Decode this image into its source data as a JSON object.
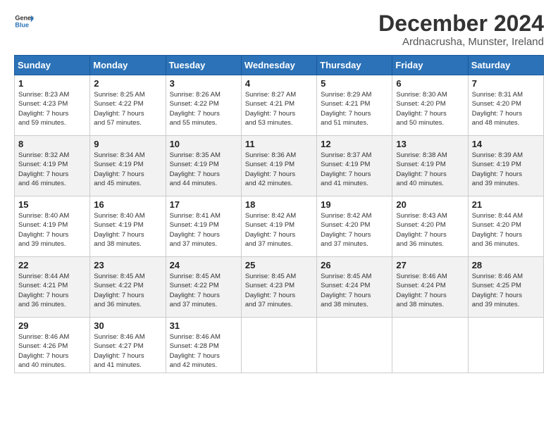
{
  "header": {
    "logo_line1": "General",
    "logo_line2": "Blue",
    "month_title": "December 2024",
    "location": "Ardnacrusha, Munster, Ireland"
  },
  "days_of_week": [
    "Sunday",
    "Monday",
    "Tuesday",
    "Wednesday",
    "Thursday",
    "Friday",
    "Saturday"
  ],
  "weeks": [
    [
      {
        "day": "1",
        "info": "Sunrise: 8:23 AM\nSunset: 4:23 PM\nDaylight: 7 hours\nand 59 minutes."
      },
      {
        "day": "2",
        "info": "Sunrise: 8:25 AM\nSunset: 4:22 PM\nDaylight: 7 hours\nand 57 minutes."
      },
      {
        "day": "3",
        "info": "Sunrise: 8:26 AM\nSunset: 4:22 PM\nDaylight: 7 hours\nand 55 minutes."
      },
      {
        "day": "4",
        "info": "Sunrise: 8:27 AM\nSunset: 4:21 PM\nDaylight: 7 hours\nand 53 minutes."
      },
      {
        "day": "5",
        "info": "Sunrise: 8:29 AM\nSunset: 4:21 PM\nDaylight: 7 hours\nand 51 minutes."
      },
      {
        "day": "6",
        "info": "Sunrise: 8:30 AM\nSunset: 4:20 PM\nDaylight: 7 hours\nand 50 minutes."
      },
      {
        "day": "7",
        "info": "Sunrise: 8:31 AM\nSunset: 4:20 PM\nDaylight: 7 hours\nand 48 minutes."
      }
    ],
    [
      {
        "day": "8",
        "info": "Sunrise: 8:32 AM\nSunset: 4:19 PM\nDaylight: 7 hours\nand 46 minutes."
      },
      {
        "day": "9",
        "info": "Sunrise: 8:34 AM\nSunset: 4:19 PM\nDaylight: 7 hours\nand 45 minutes."
      },
      {
        "day": "10",
        "info": "Sunrise: 8:35 AM\nSunset: 4:19 PM\nDaylight: 7 hours\nand 44 minutes."
      },
      {
        "day": "11",
        "info": "Sunrise: 8:36 AM\nSunset: 4:19 PM\nDaylight: 7 hours\nand 42 minutes."
      },
      {
        "day": "12",
        "info": "Sunrise: 8:37 AM\nSunset: 4:19 PM\nDaylight: 7 hours\nand 41 minutes."
      },
      {
        "day": "13",
        "info": "Sunrise: 8:38 AM\nSunset: 4:19 PM\nDaylight: 7 hours\nand 40 minutes."
      },
      {
        "day": "14",
        "info": "Sunrise: 8:39 AM\nSunset: 4:19 PM\nDaylight: 7 hours\nand 39 minutes."
      }
    ],
    [
      {
        "day": "15",
        "info": "Sunrise: 8:40 AM\nSunset: 4:19 PM\nDaylight: 7 hours\nand 39 minutes."
      },
      {
        "day": "16",
        "info": "Sunrise: 8:40 AM\nSunset: 4:19 PM\nDaylight: 7 hours\nand 38 minutes."
      },
      {
        "day": "17",
        "info": "Sunrise: 8:41 AM\nSunset: 4:19 PM\nDaylight: 7 hours\nand 37 minutes."
      },
      {
        "day": "18",
        "info": "Sunrise: 8:42 AM\nSunset: 4:19 PM\nDaylight: 7 hours\nand 37 minutes."
      },
      {
        "day": "19",
        "info": "Sunrise: 8:42 AM\nSunset: 4:20 PM\nDaylight: 7 hours\nand 37 minutes."
      },
      {
        "day": "20",
        "info": "Sunrise: 8:43 AM\nSunset: 4:20 PM\nDaylight: 7 hours\nand 36 minutes."
      },
      {
        "day": "21",
        "info": "Sunrise: 8:44 AM\nSunset: 4:20 PM\nDaylight: 7 hours\nand 36 minutes."
      }
    ],
    [
      {
        "day": "22",
        "info": "Sunrise: 8:44 AM\nSunset: 4:21 PM\nDaylight: 7 hours\nand 36 minutes."
      },
      {
        "day": "23",
        "info": "Sunrise: 8:45 AM\nSunset: 4:22 PM\nDaylight: 7 hours\nand 36 minutes."
      },
      {
        "day": "24",
        "info": "Sunrise: 8:45 AM\nSunset: 4:22 PM\nDaylight: 7 hours\nand 37 minutes."
      },
      {
        "day": "25",
        "info": "Sunrise: 8:45 AM\nSunset: 4:23 PM\nDaylight: 7 hours\nand 37 minutes."
      },
      {
        "day": "26",
        "info": "Sunrise: 8:45 AM\nSunset: 4:24 PM\nDaylight: 7 hours\nand 38 minutes."
      },
      {
        "day": "27",
        "info": "Sunrise: 8:46 AM\nSunset: 4:24 PM\nDaylight: 7 hours\nand 38 minutes."
      },
      {
        "day": "28",
        "info": "Sunrise: 8:46 AM\nSunset: 4:25 PM\nDaylight: 7 hours\nand 39 minutes."
      }
    ],
    [
      {
        "day": "29",
        "info": "Sunrise: 8:46 AM\nSunset: 4:26 PM\nDaylight: 7 hours\nand 40 minutes."
      },
      {
        "day": "30",
        "info": "Sunrise: 8:46 AM\nSunset: 4:27 PM\nDaylight: 7 hours\nand 41 minutes."
      },
      {
        "day": "31",
        "info": "Sunrise: 8:46 AM\nSunset: 4:28 PM\nDaylight: 7 hours\nand 42 minutes."
      },
      {
        "day": "",
        "info": ""
      },
      {
        "day": "",
        "info": ""
      },
      {
        "day": "",
        "info": ""
      },
      {
        "day": "",
        "info": ""
      }
    ]
  ]
}
